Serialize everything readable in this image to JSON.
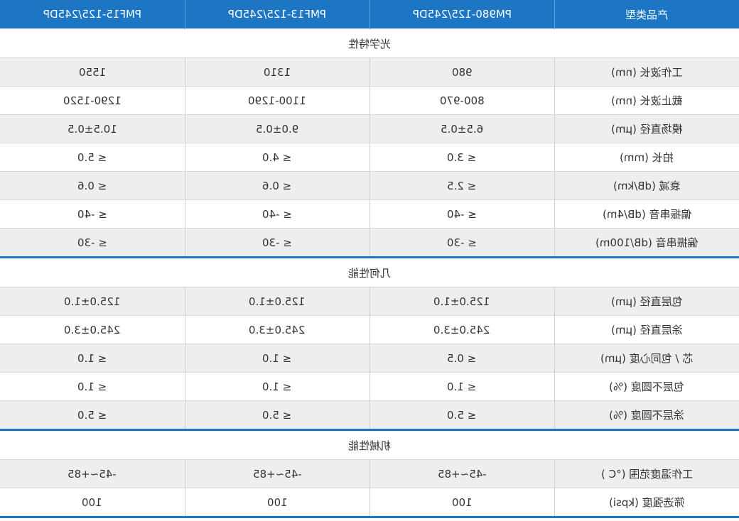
{
  "header": [
    "PMF15-125/245DP",
    "PMF13-125/245DP",
    "PM980-125/245DP",
    "产品类型"
  ],
  "sections": [
    {
      "title": "光学特性",
      "rows": [
        [
          "1550",
          "1310",
          "980",
          "工作波长 (nm)"
        ],
        [
          "1290-1520",
          "1100-1290",
          "800-970",
          "截止波长 (nm)"
        ],
        [
          "10.5±0.5",
          "9.0±0.5",
          "6.5±0.5",
          "模场直径 (μm)"
        ],
        [
          "≤ 5.0",
          "≤ 4.0",
          "≤ 3.0",
          "拍长 (mm)"
        ],
        [
          "≤ 0.6",
          "≤ 0.6",
          "≤ 2.5",
          "衰减 (dB/km)"
        ],
        [
          "≤ -40",
          "≤ -40",
          "≤ -40",
          "偏振串音 (dB/4m)"
        ],
        [
          "≤ -30",
          "≤ -30",
          "≤ -30",
          "偏振串音 (dB/100m)"
        ]
      ]
    },
    {
      "title": "几何性能",
      "rows": [
        [
          "125.0±1.0",
          "125.0±1.0",
          "125.0±1.0",
          "包层直径 (μm)"
        ],
        [
          "245.0±3.0",
          "245.0±3.0",
          "245.0±3.0",
          "涂层直径 (μm)"
        ],
        [
          "≤ 1.0",
          "≤ 1.0",
          "≤ 0.5",
          "芯 / 包同心度 (μm)"
        ],
        [
          "≤ 1.0",
          "≤ 1.0",
          "≤ 1.0",
          "包层不圆度 (%)"
        ],
        [
          "≤ 5.0",
          "≤ 5.0",
          "≤ 5.0",
          "涂层不圆度 (%)"
        ]
      ]
    },
    {
      "title": "机械性能",
      "rows": [
        [
          "-45~+85",
          "-45~+85",
          "-45~+85",
          "工作温度范围 (°C )"
        ],
        [
          "100",
          "100",
          "100",
          "筛选强度 (kpsi)"
        ]
      ]
    }
  ]
}
